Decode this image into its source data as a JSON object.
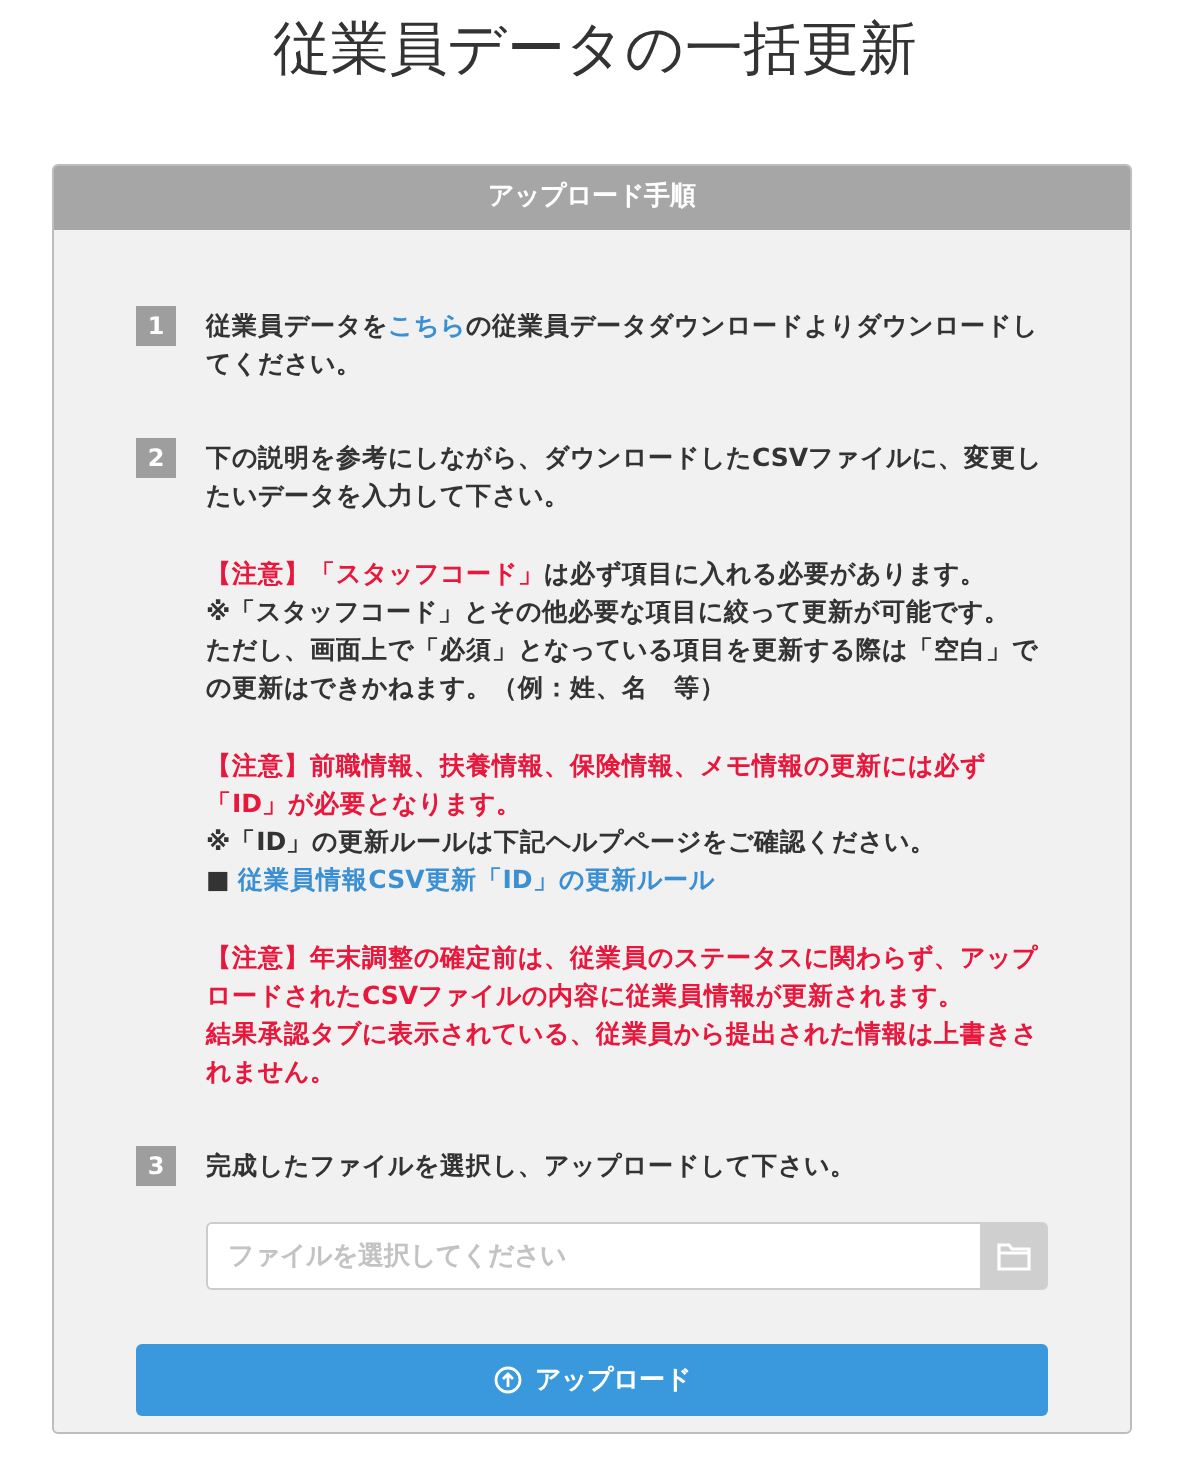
{
  "title": "従業員データの一括更新",
  "panel": {
    "header": "アップロード手順",
    "steps": [
      {
        "number": "1",
        "groups": [
          [
            [
              {
                "kind": "text",
                "text": "従業員データを"
              },
              {
                "kind": "link",
                "text": "こちら"
              },
              {
                "kind": "text",
                "text": "の従業員データダウンロードよりダウンロードしてください。"
              }
            ]
          ]
        ]
      },
      {
        "number": "2",
        "groups": [
          [
            [
              {
                "kind": "text",
                "text": "下の説明を参考にしながら、ダウンロードしたCSVファイルに、変更したいデータを入力して下さい。"
              }
            ]
          ],
          [
            [
              {
                "kind": "alert",
                "text": "【注意】「スタッフコード」"
              },
              {
                "kind": "text",
                "text": "は必ず項目に入れる必要があります。"
              }
            ],
            [
              {
                "kind": "text",
                "text": "※「スタッフコード」とその他必要な項目に絞って更新が可能です。"
              }
            ],
            [
              {
                "kind": "text",
                "text": "ただし、画面上で「必須」となっている項目を更新する際は「空白」での更新はできかねます。（例：姓、名　等）"
              }
            ]
          ],
          [
            [
              {
                "kind": "alert",
                "text": "【注意】前職情報、扶養情報、保険情報、メモ情報の更新には必ず「ID」が必要となります。"
              }
            ],
            [
              {
                "kind": "text",
                "text": "※「ID」の更新ルールは下記ヘルプページをご確認ください。"
              }
            ],
            [
              {
                "kind": "text",
                "text": "■ "
              },
              {
                "kind": "link",
                "text": "従業員情報CSV更新「ID」の更新ルール"
              }
            ]
          ],
          [
            [
              {
                "kind": "alert",
                "text": "【注意】年末調整の確定前は、従業員のステータスに関わらず、アップロードされたCSVファイルの内容に従業員情報が更新されます。"
              }
            ],
            [
              {
                "kind": "alert",
                "text": "結果承認タブに表示されている、従業員から提出された情報は上書きされません。"
              }
            ]
          ]
        ]
      },
      {
        "number": "3",
        "groups": [
          [
            [
              {
                "kind": "text",
                "text": "完成したファイルを選択し、アップロードして下さい。"
              }
            ]
          ]
        ]
      }
    ],
    "file_field": {
      "placeholder": "ファイルを選択してください"
    },
    "upload_button": "アップロード"
  }
}
